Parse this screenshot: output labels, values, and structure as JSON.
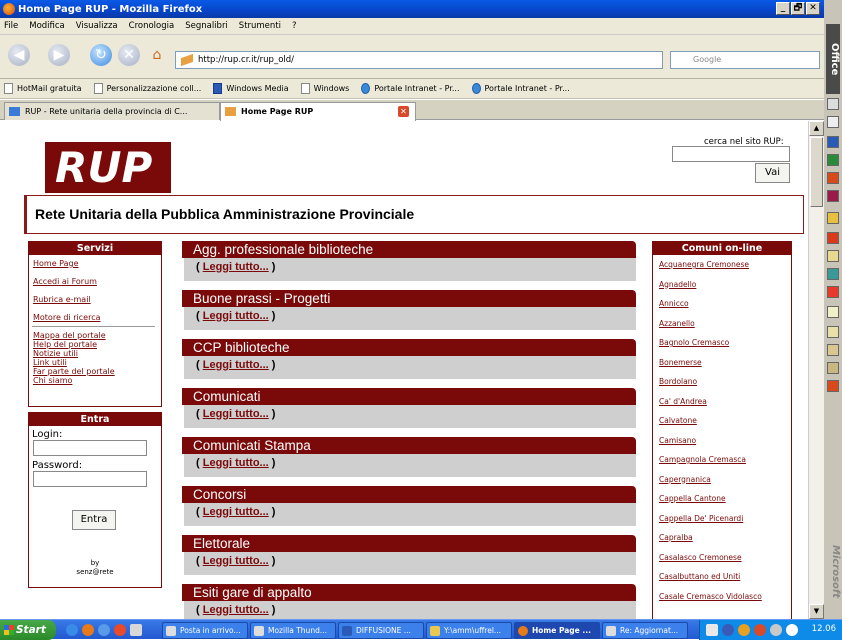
{
  "window": {
    "title": "Home Page RUP - Mozilla Firefox",
    "controls": [
      "_",
      "🗗",
      "✕"
    ]
  },
  "menu": [
    "File",
    "Modifica",
    "Visualizza",
    "Cronologia",
    "Segnalibri",
    "Strumenti",
    "?"
  ],
  "nav": {
    "url": "http://rup.cr.it/rup_old/",
    "search_engine_placeholder": "Google"
  },
  "bookmarks": [
    {
      "label": "HotMail gratuita",
      "icon": "page-icon"
    },
    {
      "label": "Personalizzazione coll...",
      "icon": "page-icon"
    },
    {
      "label": "Windows Media",
      "icon": "windows-media-icon"
    },
    {
      "label": "Windows",
      "icon": "page-icon"
    },
    {
      "label": "Portale Intranet - Pr...",
      "icon": "portal-icon"
    },
    {
      "label": "Portale Intranet - Pr...",
      "icon": "portal-icon"
    }
  ],
  "tabs": [
    {
      "label": "RUP - Rete unitaria della provincia di C...",
      "active": false
    },
    {
      "label": "Home Page RUP",
      "active": true
    }
  ],
  "page": {
    "logo": "RUP",
    "search_label": "cerca nel sito RUP:",
    "search_button": "Vai",
    "banner": "Rete Unitaria della Pubblica Amministrazione Provinciale",
    "servizi": {
      "title": "Servizi",
      "links_top": [
        "Home Page",
        "Accedi ai Forum",
        "Rubrica e-mail",
        "Motore di ricerca"
      ],
      "links_bottom": [
        "Mappa del portale",
        "Help del portale",
        "Notizie utili",
        "Link utili",
        "Far parte del portale",
        "Chi siamo"
      ]
    },
    "entra": {
      "title": "Entra",
      "login_label": "Login:",
      "password_label": "Password:",
      "button": "Entra",
      "credit_line1": "by",
      "credit_line2": "senz@rete"
    },
    "news": [
      {
        "title": "Agg. professionale biblioteche",
        "link": "Leggi tutto..."
      },
      {
        "title": "Buone prassi - Progetti",
        "link": "Leggi tutto..."
      },
      {
        "title": "CCP biblioteche",
        "link": "Leggi tutto..."
      },
      {
        "title": "Comunicati",
        "link": "Leggi tutto..."
      },
      {
        "title": "Comunicati Stampa",
        "link": "Leggi tutto..."
      },
      {
        "title": "Concorsi",
        "link": "Leggi tutto..."
      },
      {
        "title": "Elettorale",
        "link": "Leggi tutto..."
      },
      {
        "title": "Esiti gare di appalto",
        "link": "Leggi tutto..."
      }
    ],
    "comuni": {
      "title": "Comuni on-line",
      "items": [
        "Acquanegra Cremonese",
        "Agnadello",
        "Annicco",
        "Azzanello",
        "Bagnolo Cremasco",
        "Bonemerse",
        "Bordolano",
        "Ca' d'Andrea",
        "Calvatone",
        "Camisano",
        "Campagnola Cremasca",
        "Capergnanica",
        "Cappella Cantone",
        "Cappella De' Picenardi",
        "Capralba",
        "Casalasco Cremonese",
        "Casalbuttano ed Uniti",
        "Casale Cremasco Vidolasco"
      ]
    }
  },
  "office_bar": {
    "label": "Office",
    "brand": "Microsoft"
  },
  "taskbar": {
    "start": "Start",
    "items": [
      {
        "label": "Posta in arrivo...",
        "active": false
      },
      {
        "label": "Mozilla Thund...",
        "active": false
      },
      {
        "label": "DIFFUSIONE ...",
        "active": false
      },
      {
        "label": "Y:\\amm\\uffrel...",
        "active": false
      },
      {
        "label": "Home Page ...",
        "active": true
      },
      {
        "label": "Re: Aggiornat...",
        "active": false
      }
    ],
    "clock": "12.06"
  }
}
